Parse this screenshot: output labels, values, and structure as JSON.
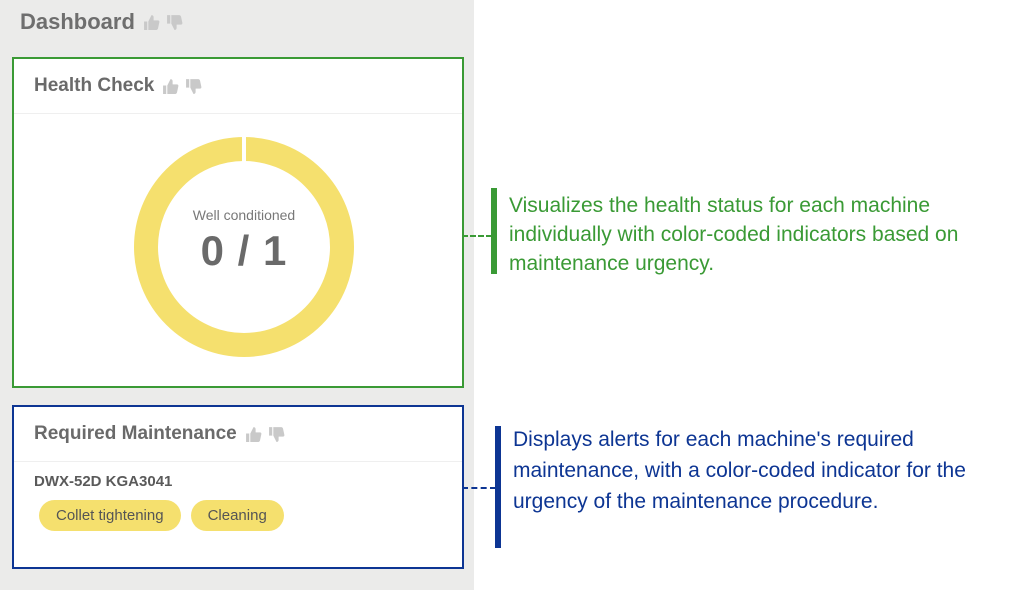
{
  "dashboard": {
    "title": "Dashboard"
  },
  "health_check": {
    "title": "Health Check",
    "label": "Well conditioned",
    "value": "0 / 1",
    "well_conditioned_fraction": 0,
    "ring_color": "#f5e06e"
  },
  "required_maintenance": {
    "title": "Required Maintenance",
    "machine": "DWX-52D KGA3041",
    "tasks": [
      "Collet tightening",
      "Cleaning"
    ],
    "chip_color": "#f5e06e"
  },
  "annotations": {
    "health": "Visualizes the health status for each machine individually with color-coded indicators based on maintenance urgency.",
    "maintenance": "Displays alerts for each machine's required maintenance, with a color-coded indicator for the urgency of the maintenance procedure."
  },
  "colors": {
    "green_accent": "#3a9a35",
    "blue_accent": "#0d3593",
    "panel_bg": "#ebebea"
  },
  "icons": [
    "thumbs-up-icon",
    "thumbs-down-icon"
  ]
}
